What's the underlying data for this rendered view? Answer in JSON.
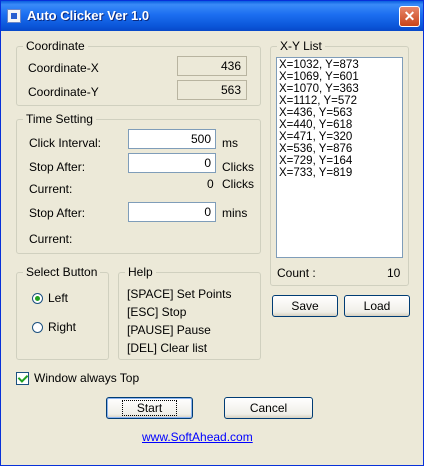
{
  "window": {
    "title": "Auto Clicker Ver 1.0",
    "close_glyph": "✕"
  },
  "coordinate": {
    "group_label": "Coordinate",
    "x_label": "Coordinate-X",
    "x_value": "436",
    "y_label": "Coordinate-Y",
    "y_value": "563"
  },
  "time_setting": {
    "group_label": "Time Setting",
    "click_interval_label": "Click Interval:",
    "click_interval_value": "500",
    "click_interval_unit": "ms",
    "stop_after_label": "Stop After:",
    "stop_after_clicks_value": "0",
    "stop_after_clicks_unit": "Clicks",
    "current_label": "Current:",
    "current_clicks_value": "0",
    "current_clicks_unit": "Clicks",
    "stop_after2_label": "Stop After:",
    "stop_after_mins_value": "0",
    "stop_after_mins_unit": "mins",
    "current2_label": "Current:"
  },
  "select_button": {
    "group_label": "Select Button",
    "left_label": "Left",
    "right_label": "Right",
    "selected": "Left"
  },
  "help": {
    "group_label": "Help",
    "lines": [
      "[SPACE] Set Points",
      "[ESC] Stop",
      "[PAUSE] Pause",
      "[DEL] Clear list"
    ]
  },
  "xy_list": {
    "group_label": "X-Y List",
    "items": [
      "X=1032, Y=873",
      "X=1069, Y=601",
      "X=1070, Y=363",
      "X=1112, Y=572",
      "X=436, Y=563",
      "X=440, Y=618",
      "X=471, Y=320",
      "X=536, Y=876",
      "X=729, Y=164",
      "X=733, Y=819"
    ],
    "count_label": "Count :",
    "count_value": "10",
    "save_label": "Save",
    "load_label": "Load"
  },
  "window_always_top": {
    "label": "Window always Top",
    "checked": true
  },
  "buttons": {
    "start_label": "Start",
    "cancel_label": "Cancel"
  },
  "link": {
    "text": "www.SoftAhead.com"
  }
}
